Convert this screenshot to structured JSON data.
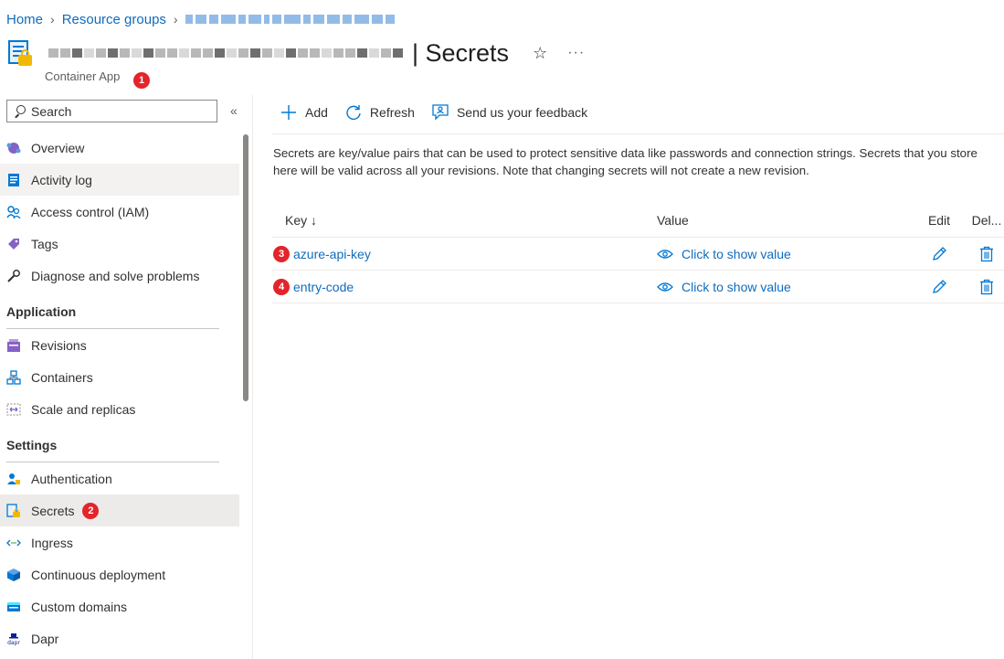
{
  "breadcrumb": {
    "home": "Home",
    "resource_groups": "Resource groups"
  },
  "header": {
    "title": "| Secrets",
    "subtitle": "Container App",
    "badge": "1"
  },
  "sidebar": {
    "search_placeholder": "Search",
    "collapse": "«",
    "items_top": [
      {
        "label": "Overview",
        "icon": "overview-icon"
      },
      {
        "label": "Activity log",
        "icon": "activity-log-icon"
      },
      {
        "label": "Access control (IAM)",
        "icon": "iam-icon"
      },
      {
        "label": "Tags",
        "icon": "tag-icon"
      },
      {
        "label": "Diagnose and solve problems",
        "icon": "wrench-icon"
      }
    ],
    "section_application": "Application",
    "items_application": [
      {
        "label": "Revisions",
        "icon": "revisions-icon"
      },
      {
        "label": "Containers",
        "icon": "containers-icon"
      },
      {
        "label": "Scale and replicas",
        "icon": "scale-icon"
      }
    ],
    "section_settings": "Settings",
    "items_settings": [
      {
        "label": "Authentication",
        "icon": "authentication-icon"
      },
      {
        "label": "Secrets",
        "icon": "secrets-icon",
        "badge": "2"
      },
      {
        "label": "Ingress",
        "icon": "ingress-icon"
      },
      {
        "label": "Continuous deployment",
        "icon": "deployment-icon"
      },
      {
        "label": "Custom domains",
        "icon": "domains-icon"
      },
      {
        "label": "Dapr",
        "icon": "dapr-icon"
      }
    ]
  },
  "toolbar": {
    "add": "Add",
    "refresh": "Refresh",
    "feedback": "Send us your feedback"
  },
  "description": "Secrets are key/value pairs that can be used to protect sensitive data like passwords and connection strings. Secrets that you store here will be valid across all your revisions. Note that changing secrets will not create a new revision.",
  "table": {
    "headers": {
      "key": "Key ↓",
      "value": "Value",
      "edit": "Edit",
      "delete": "Del..."
    },
    "rows": [
      {
        "key": "azure-api-key",
        "value": "Click to show value",
        "badge": "3"
      },
      {
        "key": "entry-code",
        "value": "Click to show value",
        "badge": "4"
      }
    ]
  },
  "colors": {
    "accent": "#0f6cbd",
    "badge": "#e3242b",
    "selected": "#edebe9"
  }
}
